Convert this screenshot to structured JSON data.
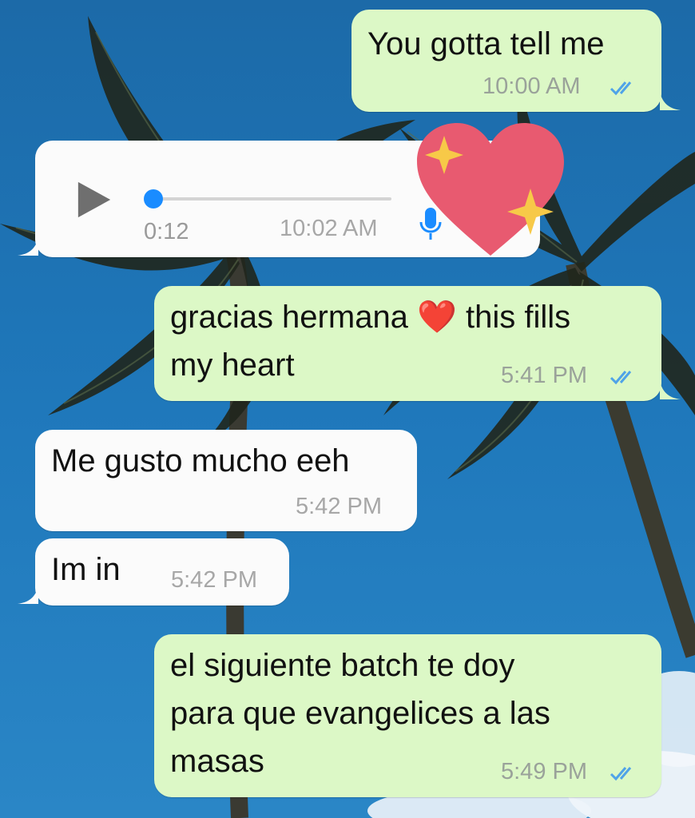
{
  "colors": {
    "outgoing_bubble": "#dcf8c6",
    "incoming_bubble": "#fbfbfb",
    "read_ticks": "#4fa3e8",
    "voice_accent": "#1a8cff",
    "wallpaper_sky": "#1b6fb0"
  },
  "wallpaper": {
    "description_icon": "palm-trees-icon"
  },
  "messages": [
    {
      "direction": "outgoing",
      "text": "You gotta tell me",
      "time": "10:00 AM",
      "status": "read"
    },
    {
      "direction": "incoming",
      "type": "voice",
      "duration": "0:12",
      "time": "10:02 AM",
      "icon": "microphone-icon",
      "sticker": "sparkling-heart-icon"
    },
    {
      "direction": "outgoing",
      "text_line1": "gracias hermana",
      "emoji": "❤️",
      "text_line1b": "this fills",
      "text_line2": "my heart",
      "time": "5:41 PM",
      "status": "read"
    },
    {
      "direction": "incoming",
      "text": "Me gusto mucho eeh",
      "time": "5:42 PM"
    },
    {
      "direction": "incoming",
      "text": "Im in",
      "time": "5:42 PM"
    },
    {
      "direction": "outgoing",
      "text_line1": "el siguiente batch te doy",
      "text_line2": "para que evangelices a las",
      "text_line3": "masas",
      "time": "5:49 PM",
      "status": "read"
    }
  ]
}
